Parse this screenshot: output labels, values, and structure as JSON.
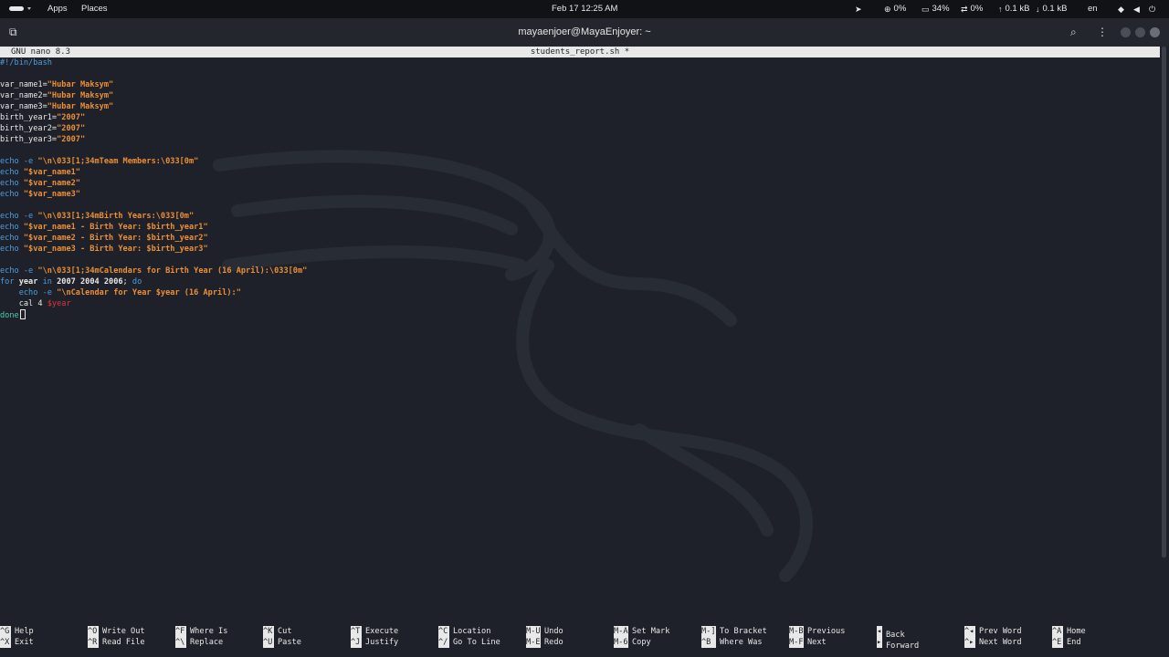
{
  "topbar": {
    "apps": "Apps",
    "places": "Places",
    "clock": "Feb 17  12:25 AM",
    "cpu": "0%",
    "mem": "34%",
    "swap": "0%",
    "net_up": "0.1 kB",
    "net_down": "0.1 kB",
    "lang": "en",
    "icons": [
      "activities-icon",
      "telegram-icon",
      "cpu-icon",
      "memory-icon",
      "swap-icon",
      "upload-icon",
      "download-icon",
      "wifi-icon",
      "volume-icon",
      "power-icon"
    ]
  },
  "window": {
    "title": "mayaenjoer@MayaEnjoyer: ~",
    "icons": [
      "new-tab-icon",
      "search-icon",
      "menu-icon",
      "minimize-icon",
      "maximize-icon",
      "close-icon"
    ]
  },
  "nano": {
    "version": "GNU nano 8.3",
    "filename": "students_report.sh *"
  },
  "code": {
    "l1": "#!/bin/bash",
    "l3a": "var_name1=",
    "l3b": "\"Hubar Maksym\"",
    "l4a": "var_name2=",
    "l4b": "\"Hubar Maksym\"",
    "l5a": "var_name3=",
    "l5b": "\"Hubar Maksym\"",
    "l6a": "birth_year1=",
    "l6b": "\"2007\"",
    "l7a": "birth_year2=",
    "l7b": "\"2007\"",
    "l8a": "birth_year3=",
    "l8b": "\"2007\"",
    "echo": "echo",
    "opt_e": " -e ",
    "l10b": "\"\\n\\033[1;34mTeam Members:\\033[0m\"",
    "l11b": " \"$var_name1\"",
    "l12b": " \"$var_name2\"",
    "l13b": " \"$var_name3\"",
    "l15b": "\"\\n\\033[1;34mBirth Years:\\033[0m\"",
    "l16b": " \"$var_name1 - Birth Year: $birth_year1\"",
    "l17b": " \"$var_name2 - Birth Year: $birth_year2\"",
    "l18b": " \"$var_name3 - Birth Year: $birth_year3\"",
    "l20b": "\"\\n\\033[1;34mCalendars for Birth Year (16 April):\\033[0m\"",
    "l21_for": "for",
    "l21_year": " year ",
    "l21_in": "in",
    "l21_list": " 2007 2004 2006",
    "l21_semi": "; ",
    "l21_do": "do",
    "l22_indent": "    ",
    "l22b": "\"\\nCalendar for Year $year (16 April):\"",
    "l23_cal": "    cal 4 ",
    "l23_var": "$year",
    "l24": "done"
  },
  "shortcuts": [
    {
      "k1": "^G",
      "l1": "Help",
      "k2": "^X",
      "l2": "Exit"
    },
    {
      "k1": "^O",
      "l1": "Write Out",
      "k2": "^R",
      "l2": "Read File"
    },
    {
      "k1": "^F",
      "l1": "Where Is",
      "k2": "^\\",
      "l2": "Replace"
    },
    {
      "k1": "^K",
      "l1": "Cut",
      "k2": "^U",
      "l2": "Paste"
    },
    {
      "k1": "^T",
      "l1": "Execute",
      "k2": "^J",
      "l2": "Justify"
    },
    {
      "k1": "^C",
      "l1": "Location",
      "k2": "^/",
      "l2": "Go To Line"
    },
    {
      "k1": "M-U",
      "l1": "Undo",
      "k2": "M-E",
      "l2": "Redo"
    },
    {
      "k1": "M-A",
      "l1": "Set Mark",
      "k2": "M-6",
      "l2": "Copy"
    },
    {
      "k1": "M-]",
      "l1": "To Bracket",
      "k2": "^B",
      "l2": "Where Was"
    },
    {
      "k1": "M-B",
      "l1": "Previous",
      "k2": "M-F",
      "l2": "Next"
    },
    {
      "k1": "◂",
      "l1": "Back",
      "k2": "▸",
      "l2": "Forward"
    },
    {
      "k1": "^◂",
      "l1": "Prev Word",
      "k2": "^▸",
      "l2": "Next Word"
    },
    {
      "k1": "^A",
      "l1": "Home",
      "k2": "^E",
      "l2": "End"
    }
  ]
}
